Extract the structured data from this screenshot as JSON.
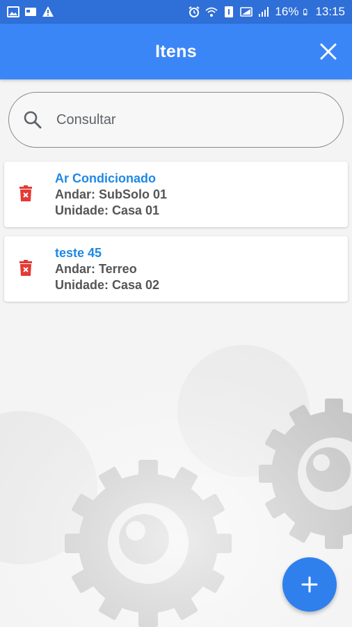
{
  "status_bar": {
    "battery": "16%",
    "time": "13:15"
  },
  "header": {
    "title": "Itens"
  },
  "search": {
    "placeholder": "Consultar"
  },
  "items": [
    {
      "title": "Ar Condicionado",
      "floor": "Andar: SubSolo 01",
      "unit": "Unidade: Casa 01"
    },
    {
      "title": "teste 45",
      "floor": "Andar: Terreo",
      "unit": "Unidade: Casa 02"
    }
  ],
  "colors": {
    "status_bar": "#2f6fd8",
    "app_bar": "#3b86f6",
    "item_title": "#1e88e5",
    "delete_icon": "#e53935",
    "fab": "#2f80ed"
  },
  "icons": {
    "close": "close-icon",
    "search": "search-icon",
    "delete": "trash-icon",
    "fab": "plus-icon"
  }
}
